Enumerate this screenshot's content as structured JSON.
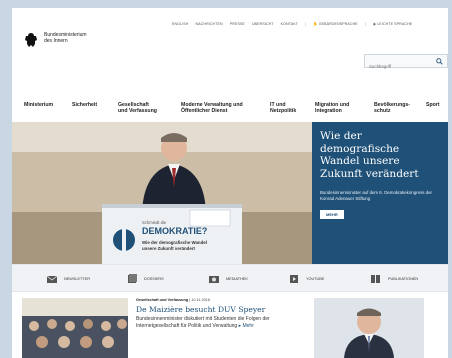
{
  "ministry": {
    "line1": "Bundesministerium",
    "line2": "des Innern"
  },
  "utility_nav": [
    "ENGLISH",
    "NACHRICHTEN",
    "PRESSE",
    "ÜBERSICHT",
    "KONTAKT",
    "GEBÄRDENSPRACHE",
    "LEICHTE SPRACHE"
  ],
  "search": {
    "placeholder": "Suchbegriff"
  },
  "nav": {
    "items": [
      {
        "line1": "Ministerium",
        "line2": ""
      },
      {
        "line1": "Sicherheit",
        "line2": ""
      },
      {
        "line1": "Gesellschaft",
        "line2": "und Verfassung"
      },
      {
        "line1": "Moderne Verwaltung und",
        "line2": "Öffentlicher Dienst"
      },
      {
        "line1": "IT und",
        "line2": "Netzpolitik"
      },
      {
        "line1": "Migration und",
        "line2": "Integration"
      },
      {
        "line1": "Bevölkerungs-",
        "line2": "schutz"
      },
      {
        "line1": "Sport",
        "line2": ""
      }
    ]
  },
  "hero": {
    "title": "Wie der demografische Wandel unsere Zukunft verändert",
    "subtitle": "Bundesinnenminister auf dem 6. Demokratiekongress der Konrad Adenauer Stiftung",
    "button": "MEHR",
    "podium_small": "Schmiedt die",
    "podium_big": "DEMOKRATIE?",
    "podium_line2": "Wie der demografische Wandel",
    "podium_line3": "unsere Zukunft verändert"
  },
  "shortcuts": [
    {
      "label": "NEWSLETTER",
      "icon": "newsletter-icon"
    },
    {
      "label": "DOSSIERS",
      "icon": "dossiers-icon"
    },
    {
      "label": "MEDIATHEK",
      "icon": "mediathek-icon"
    },
    {
      "label": "YOUTUBE",
      "icon": "youtube-icon"
    },
    {
      "label": "PUBLIKATIONEN",
      "icon": "publikationen-icon"
    }
  ],
  "news": {
    "category": "Gesellschaft und Verfassung",
    "date": "10.11.2016",
    "title": "De Maizière besucht DUV Speyer",
    "text": "Bundesinnenminister diskutiert mit Studenten die Folgen der Internetgesellschaft für Politik und Verwaltung",
    "more": "Mehr"
  },
  "colors": {
    "brand_blue": "#1f5078",
    "background": "#c9d6e3"
  }
}
